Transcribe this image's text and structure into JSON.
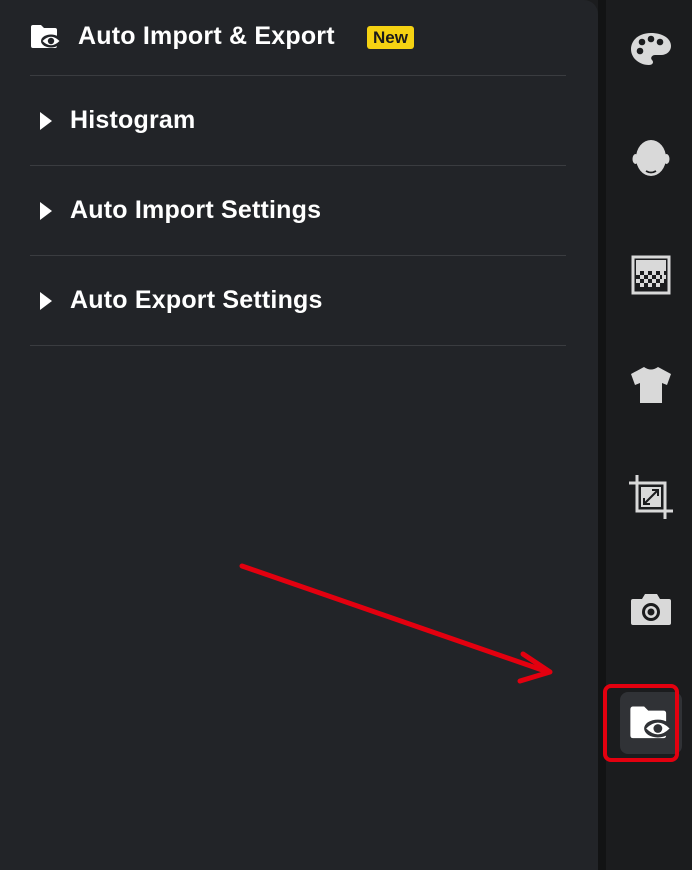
{
  "panel": {
    "title": "Auto Import & Export",
    "badge": "New",
    "sections": [
      {
        "label": "Histogram",
        "expanded": false
      },
      {
        "label": "Auto Import Settings",
        "expanded": false
      },
      {
        "label": "Auto Export Settings",
        "expanded": false
      }
    ]
  },
  "toolbar": {
    "items": [
      {
        "icon": "palette-icon"
      },
      {
        "icon": "face-icon"
      },
      {
        "icon": "gradient-filter-icon"
      },
      {
        "icon": "shirt-icon"
      },
      {
        "icon": "crop-icon"
      },
      {
        "icon": "camera-icon"
      },
      {
        "icon": "folder-eye-icon",
        "active": true
      }
    ]
  },
  "colors": {
    "badge": "#f5d212",
    "highlight": "#e3000f",
    "arrow": "#e3000f"
  }
}
